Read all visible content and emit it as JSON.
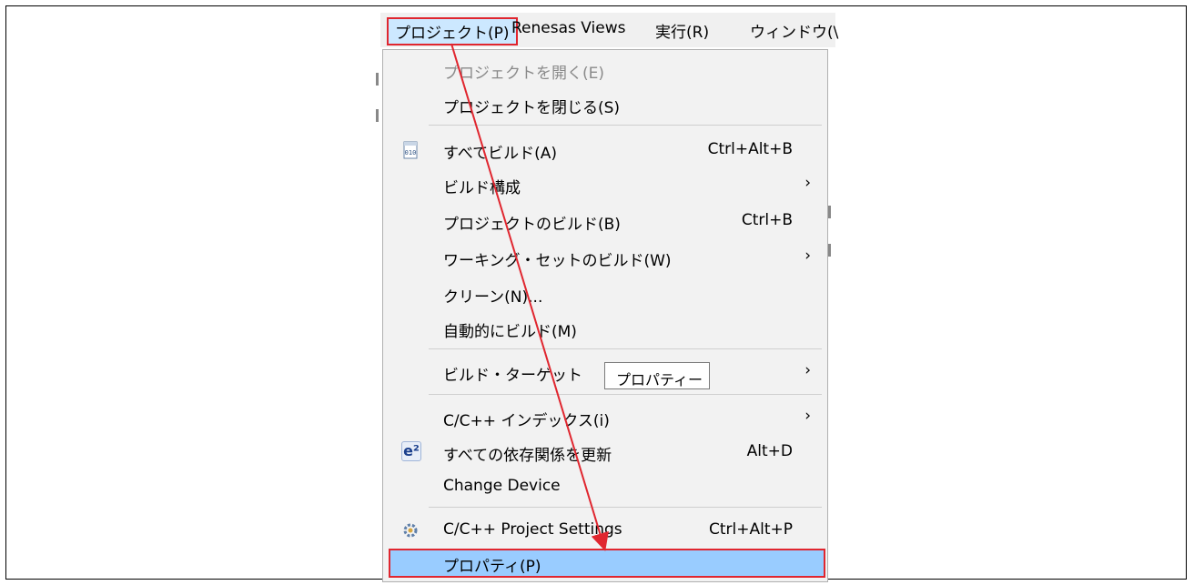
{
  "menubar": {
    "items": [
      "プロジェクト(P)",
      "Renesas Views",
      "実行(R)",
      "ウィンドウ(\\"
    ]
  },
  "menu": {
    "items": [
      {
        "label": "プロジェクトを開く(E)",
        "enabled": false
      },
      {
        "label": "プロジェクトを閉じる(S)"
      },
      {
        "label": "すべてビルド(A)",
        "accel": "Ctrl+Alt+B",
        "icon": "build-all-icon"
      },
      {
        "label": "ビルド構成",
        "submenu": "›"
      },
      {
        "label": "プロジェクトのビルド(B)",
        "accel": "Ctrl+B"
      },
      {
        "label": "ワーキング・セットのビルド(W)",
        "submenu": "›"
      },
      {
        "label": "クリーン(N)..."
      },
      {
        "label": "自動的にビルド(M)"
      },
      {
        "label": "ビルド・ターゲット",
        "submenu": "›"
      },
      {
        "label": "C/C++ インデックス(i)",
        "submenu": "›"
      },
      {
        "label": "すべての依存関係を更新",
        "accel": "Alt+D",
        "icon": "e2-icon"
      },
      {
        "label": "Change Device"
      },
      {
        "label": "C/C++ Project Settings",
        "accel": "Ctrl+Alt+P",
        "icon": "settings-icon"
      },
      {
        "label": "プロパティ(P)",
        "highlighted": true
      }
    ]
  },
  "tooltip": "プロパティー",
  "e2_glyph": "e²",
  "colors": {
    "highlight": "#99ccff",
    "arrow": "#e0262f"
  }
}
